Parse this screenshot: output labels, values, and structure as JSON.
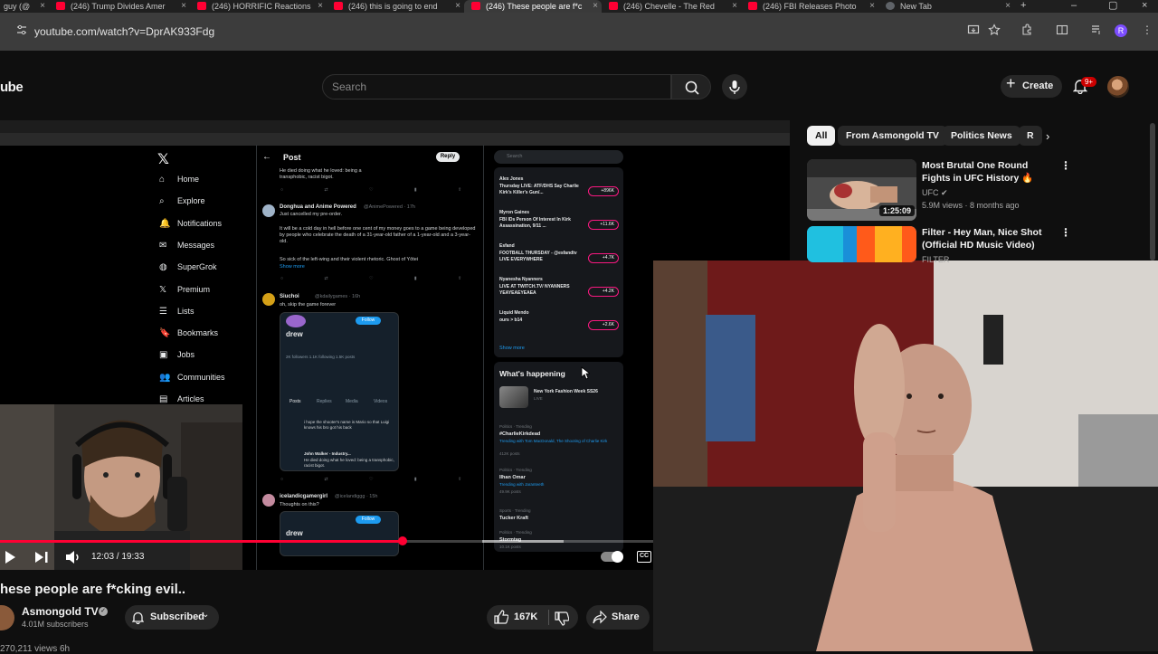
{
  "browser": {
    "tabs": [
      {
        "label": "guy (@",
        "active": false
      },
      {
        "label": "(246) Trump Divides Amer",
        "active": false
      },
      {
        "label": "(246) HORRIFIC Reactions",
        "active": false
      },
      {
        "label": "(246) this is going to end",
        "active": false
      },
      {
        "label": "(246) These people are f*c",
        "active": true
      },
      {
        "label": "(246) Chevelle - The Red",
        "active": false
      },
      {
        "label": "(246) FBI Releases Photo",
        "active": false
      },
      {
        "label": "New Tab",
        "active": false
      }
    ],
    "url": "youtube.com/watch?v=DprAK933Fdg",
    "profile_initial": "R"
  },
  "youtube": {
    "logo_text": "ube",
    "search_placeholder": "Search",
    "create_label": "Create",
    "notification_badge": "9+"
  },
  "video": {
    "title": "hese people are f*cking evil..",
    "channel": "Asmongold TV",
    "subscribers": "4.01M subscribers",
    "subscribe_label": "Subscribed",
    "likes": "167K",
    "share_label": "Share",
    "time_display": "12:03 / 19:33",
    "progress_fraction": 0.617,
    "bottom_text": "270,211 views 6h",
    "cc_label": "CC"
  },
  "embedded_x": {
    "nav": [
      {
        "label": "Home",
        "icon": "home-icon"
      },
      {
        "label": "Explore",
        "icon": "search-icon"
      },
      {
        "label": "Notifications",
        "icon": "bell-icon"
      },
      {
        "label": "Messages",
        "icon": "mail-icon"
      },
      {
        "label": "SuperGrok",
        "icon": "grok-icon"
      },
      {
        "label": "Premium",
        "icon": "x-icon"
      },
      {
        "label": "Lists",
        "icon": "list-icon"
      },
      {
        "label": "Bookmarks",
        "icon": "bookmark-icon"
      },
      {
        "label": "Jobs",
        "icon": "briefcase-icon"
      },
      {
        "label": "Communities",
        "icon": "people-icon"
      },
      {
        "label": "Articles",
        "icon": "article-icon"
      }
    ],
    "post_header": "Post",
    "reply_label": "Reply",
    "search_label": "Search",
    "tweet1_text": "He died doing what he loved: being a transphobic, racist bigot.",
    "tweet2_name": "Donghua and Anime Powered",
    "tweet2_handle": "@AnimePowered · 17h",
    "tweet2_text_1": "Just cancelled my pre-order.",
    "tweet2_text_2": "It will be a cold day in hell before one cent of my money goes to a game being developed by people who celebrate the death of a 31-year-old father of a 1-year-old and a 3-year-old.",
    "tweet2_text_3": "So sick of the left-wing and their violent rhetoric. Ghost of Yōtei",
    "show_more": "Show more",
    "tweet3_name": "Siuchoi",
    "tweet3_handle": "@kdailygames · 16h",
    "tweet3_text": "oh, skip the game forever",
    "card_name": "drew",
    "card_follow": "Follow",
    "card_stats": "2K followers  1.1K following  1.5K posts",
    "card_tabs": [
      "Posts",
      "Replies",
      "Media",
      "Videos"
    ],
    "card_post": "i hope the shooter's name is Mario so that Luigi knows his bro got his back",
    "card_reply_name": "John Walker - Industry...",
    "card_reply_text": "He died doing what he loved: being a transphobic, racist bigot.",
    "tweet4_name": "icelandicgamergirl",
    "tweet4_handle": "@icelandiggg · 15h",
    "tweet4_text": "Thoughts on this?",
    "live": [
      {
        "name": "Alex Jones",
        "title": "Thursday LIVE: ATF/DHS Say Charlie Kirk's Killer's Gun/...",
        "count": "+896K"
      },
      {
        "name": "Myron Gaines",
        "title": "FBI IDs Person Of Interest In Kirk Assassination, 9/11 ...",
        "count": "+11.6K"
      },
      {
        "name": "Esfand",
        "title": "FOOTBALL THURSDAY - @esfandtv LIVE EVERYWHERE",
        "count": "+4.7K"
      },
      {
        "name": "Nyanesha Nyanners",
        "title": "LIVE AT TWITCH.TV/ NYANNERS YEAYEAEYEAEA",
        "count": "+4.2K"
      },
      {
        "name": "Liquid Mendo",
        "title": "ours > b14",
        "count": "+2.6K"
      }
    ],
    "live_show_more": "Show more",
    "whats_happening": "What's happening",
    "happening_event": "New York Fashion Week SS26",
    "happening_live": "LIVE",
    "trends": [
      {
        "context": "Politics · Trending",
        "name": "#CharlieKirkdead",
        "sub": "Trending with Tom MacDonald, The Shooting of Charlie Kirk",
        "posts": "412K posts"
      },
      {
        "context": "Politics · Trending",
        "name": "Ilhan Omar",
        "sub": "Trending with Jaranteeth",
        "posts": "49.9K posts"
      },
      {
        "context": "Sports · Trending",
        "name": "Tucker Kraft",
        "sub": "",
        "posts": ""
      },
      {
        "context": "Politics · Trending",
        "name": "Stormtag",
        "sub": "",
        "posts": "10.1K posts"
      }
    ]
  },
  "recommendations": {
    "chips": [
      {
        "label": "All",
        "active": true
      },
      {
        "label": "From Asmongold TV",
        "active": false
      },
      {
        "label": "Politics News",
        "active": false
      },
      {
        "label": "R",
        "active": false
      }
    ],
    "items": [
      {
        "title": "Most Brutal One Round Fights in UFC History 🔥",
        "channel": "UFC",
        "meta": "5.9M views · 8 months ago",
        "duration": "1:25:09"
      },
      {
        "title": "Filter - Hey Man, Nice Shot (Official HD Music Video)",
        "channel": "FILTER",
        "meta": "",
        "duration": ""
      }
    ]
  },
  "colors": {
    "accent_red": "#ff0033",
    "x_blue": "#1d9bf0",
    "bg": "#0f0f0f"
  }
}
